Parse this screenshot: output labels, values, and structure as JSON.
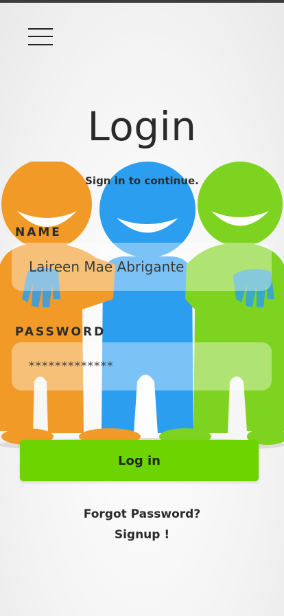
{
  "header": {
    "menu_icon": "hamburger-menu-icon"
  },
  "title": "Login",
  "subtitle": "Sign in to continue.",
  "form": {
    "name_label": "NAME",
    "name_value": "Laireen Mae Abrigante",
    "password_label": "PASSWORD",
    "password_value": "*************"
  },
  "actions": {
    "login_label": "Log in",
    "forgot_label": "Forgot Password?",
    "signup_label": "Signup !"
  },
  "colors": {
    "accent_green": "#6dd400",
    "person_orange": "#f29a27",
    "person_blue": "#2b9ef0",
    "person_green": "#7ed321"
  },
  "illustration": "three-smiling-people-icon"
}
